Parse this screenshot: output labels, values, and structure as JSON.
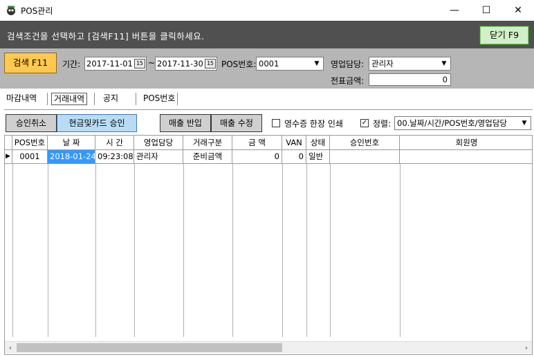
{
  "window": {
    "title": "POS관리",
    "minimize": "—",
    "maximize": "☐",
    "close": "✕"
  },
  "banner": {
    "message": "검색조건을 선택하고 [검색F11] 버튼을 클릭하세요.",
    "close_button": "닫기 F9"
  },
  "search": {
    "button": "검색 F11",
    "period_label": "기간:",
    "date_from": "2017-11-01",
    "tilde": "~",
    "date_to": "2017-11-30",
    "calendar_glyph": "15",
    "pos_label": "POS번호:",
    "pos_value": "0001",
    "sales_rep_label": "영업담당:",
    "sales_rep_value": "관리자",
    "slip_amount_label": "전표금액:",
    "slip_amount_value": "0"
  },
  "tabs": [
    "마감내역",
    "거래내역",
    "공지",
    "POS번호"
  ],
  "toolbar": {
    "cancel_approval": "승인취소",
    "cash_card_approval": "현금및카드 승인",
    "sales_return": "매출 반입",
    "sales_edit": "매출 수정",
    "receipt_label": "영수증 한장 인쇄",
    "receipt_checked": false,
    "sort_label": "정렬:",
    "sort_checked": true,
    "sort_value": "00.날짜/시간/POS번호/영업담당"
  },
  "grid": {
    "columns": [
      "POS번호",
      "날 짜",
      "시 간",
      "영업담당",
      "거래구분",
      "금  액",
      "VAN",
      "상태",
      "승인번호",
      "회원명"
    ],
    "rows": [
      {
        "pos": "0001",
        "date": "2018-01-24",
        "time": "09:23:08",
        "rep": "관리자",
        "type": "준비금액",
        "amount": "0",
        "van": "0",
        "status": "일반",
        "approval": "",
        "member": ""
      }
    ]
  },
  "colors": {
    "banner_bg": "#505050",
    "search_bg": "#b6b6b6",
    "search_button": "#ffc94f",
    "close_button": "#d2f0c8",
    "approval_button": "#b9dcf5",
    "selection": "#3399ff"
  }
}
